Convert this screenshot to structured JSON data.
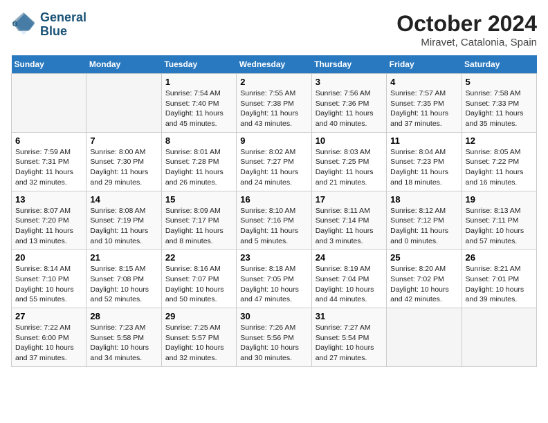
{
  "header": {
    "logo_general": "General",
    "logo_blue": "Blue",
    "month": "October 2024",
    "location": "Miravet, Catalonia, Spain"
  },
  "columns": [
    "Sunday",
    "Monday",
    "Tuesday",
    "Wednesday",
    "Thursday",
    "Friday",
    "Saturday"
  ],
  "weeks": [
    [
      {
        "day": "",
        "info": ""
      },
      {
        "day": "",
        "info": ""
      },
      {
        "day": "1",
        "info": "Sunrise: 7:54 AM\nSunset: 7:40 PM\nDaylight: 11 hours and 45 minutes."
      },
      {
        "day": "2",
        "info": "Sunrise: 7:55 AM\nSunset: 7:38 PM\nDaylight: 11 hours and 43 minutes."
      },
      {
        "day": "3",
        "info": "Sunrise: 7:56 AM\nSunset: 7:36 PM\nDaylight: 11 hours and 40 minutes."
      },
      {
        "day": "4",
        "info": "Sunrise: 7:57 AM\nSunset: 7:35 PM\nDaylight: 11 hours and 37 minutes."
      },
      {
        "day": "5",
        "info": "Sunrise: 7:58 AM\nSunset: 7:33 PM\nDaylight: 11 hours and 35 minutes."
      }
    ],
    [
      {
        "day": "6",
        "info": "Sunrise: 7:59 AM\nSunset: 7:31 PM\nDaylight: 11 hours and 32 minutes."
      },
      {
        "day": "7",
        "info": "Sunrise: 8:00 AM\nSunset: 7:30 PM\nDaylight: 11 hours and 29 minutes."
      },
      {
        "day": "8",
        "info": "Sunrise: 8:01 AM\nSunset: 7:28 PM\nDaylight: 11 hours and 26 minutes."
      },
      {
        "day": "9",
        "info": "Sunrise: 8:02 AM\nSunset: 7:27 PM\nDaylight: 11 hours and 24 minutes."
      },
      {
        "day": "10",
        "info": "Sunrise: 8:03 AM\nSunset: 7:25 PM\nDaylight: 11 hours and 21 minutes."
      },
      {
        "day": "11",
        "info": "Sunrise: 8:04 AM\nSunset: 7:23 PM\nDaylight: 11 hours and 18 minutes."
      },
      {
        "day": "12",
        "info": "Sunrise: 8:05 AM\nSunset: 7:22 PM\nDaylight: 11 hours and 16 minutes."
      }
    ],
    [
      {
        "day": "13",
        "info": "Sunrise: 8:07 AM\nSunset: 7:20 PM\nDaylight: 11 hours and 13 minutes."
      },
      {
        "day": "14",
        "info": "Sunrise: 8:08 AM\nSunset: 7:19 PM\nDaylight: 11 hours and 10 minutes."
      },
      {
        "day": "15",
        "info": "Sunrise: 8:09 AM\nSunset: 7:17 PM\nDaylight: 11 hours and 8 minutes."
      },
      {
        "day": "16",
        "info": "Sunrise: 8:10 AM\nSunset: 7:16 PM\nDaylight: 11 hours and 5 minutes."
      },
      {
        "day": "17",
        "info": "Sunrise: 8:11 AM\nSunset: 7:14 PM\nDaylight: 11 hours and 3 minutes."
      },
      {
        "day": "18",
        "info": "Sunrise: 8:12 AM\nSunset: 7:12 PM\nDaylight: 11 hours and 0 minutes."
      },
      {
        "day": "19",
        "info": "Sunrise: 8:13 AM\nSunset: 7:11 PM\nDaylight: 10 hours and 57 minutes."
      }
    ],
    [
      {
        "day": "20",
        "info": "Sunrise: 8:14 AM\nSunset: 7:10 PM\nDaylight: 10 hours and 55 minutes."
      },
      {
        "day": "21",
        "info": "Sunrise: 8:15 AM\nSunset: 7:08 PM\nDaylight: 10 hours and 52 minutes."
      },
      {
        "day": "22",
        "info": "Sunrise: 8:16 AM\nSunset: 7:07 PM\nDaylight: 10 hours and 50 minutes."
      },
      {
        "day": "23",
        "info": "Sunrise: 8:18 AM\nSunset: 7:05 PM\nDaylight: 10 hours and 47 minutes."
      },
      {
        "day": "24",
        "info": "Sunrise: 8:19 AM\nSunset: 7:04 PM\nDaylight: 10 hours and 44 minutes."
      },
      {
        "day": "25",
        "info": "Sunrise: 8:20 AM\nSunset: 7:02 PM\nDaylight: 10 hours and 42 minutes."
      },
      {
        "day": "26",
        "info": "Sunrise: 8:21 AM\nSunset: 7:01 PM\nDaylight: 10 hours and 39 minutes."
      }
    ],
    [
      {
        "day": "27",
        "info": "Sunrise: 7:22 AM\nSunset: 6:00 PM\nDaylight: 10 hours and 37 minutes."
      },
      {
        "day": "28",
        "info": "Sunrise: 7:23 AM\nSunset: 5:58 PM\nDaylight: 10 hours and 34 minutes."
      },
      {
        "day": "29",
        "info": "Sunrise: 7:25 AM\nSunset: 5:57 PM\nDaylight: 10 hours and 32 minutes."
      },
      {
        "day": "30",
        "info": "Sunrise: 7:26 AM\nSunset: 5:56 PM\nDaylight: 10 hours and 30 minutes."
      },
      {
        "day": "31",
        "info": "Sunrise: 7:27 AM\nSunset: 5:54 PM\nDaylight: 10 hours and 27 minutes."
      },
      {
        "day": "",
        "info": ""
      },
      {
        "day": "",
        "info": ""
      }
    ]
  ]
}
